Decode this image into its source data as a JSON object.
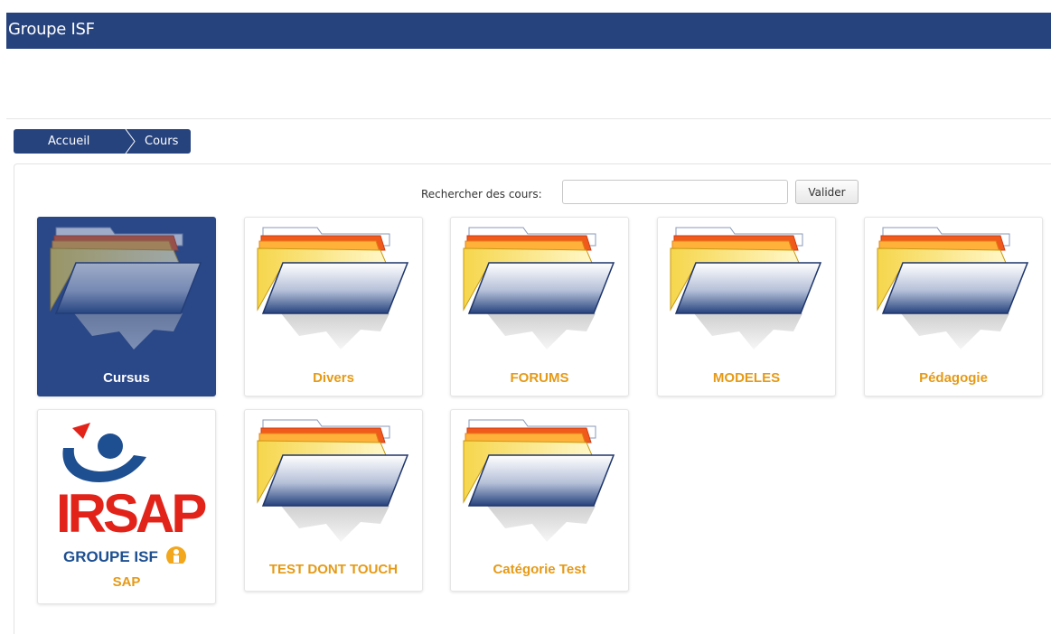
{
  "header": {
    "title": "Groupe ISF"
  },
  "breadcrumb": {
    "home": "Accueil",
    "current": "Cours"
  },
  "search": {
    "label": "Rechercher des cours:",
    "value": "",
    "placeholder": "",
    "button": "Valider"
  },
  "categories": [
    {
      "label": "Cursus",
      "icon": "folder-icon",
      "active": true
    },
    {
      "label": "Divers",
      "icon": "folder-icon"
    },
    {
      "label": "FORUMS",
      "icon": "folder-icon"
    },
    {
      "label": "MODELES",
      "icon": "folder-icon"
    },
    {
      "label": "Pédagogie",
      "icon": "folder-icon"
    },
    {
      "label": "SAP",
      "icon": "irsap-logo",
      "logo_text": "IRSAP",
      "logo_sub": "GROUPE ISF"
    },
    {
      "label": "TEST DONT TOUCH",
      "icon": "folder-icon"
    },
    {
      "label": "Catégorie Test",
      "icon": "folder-icon"
    }
  ],
  "colors": {
    "header": "#26437d",
    "accent": "#e59a17",
    "logo_red": "#e2231a",
    "logo_blue": "#1d4f91"
  }
}
